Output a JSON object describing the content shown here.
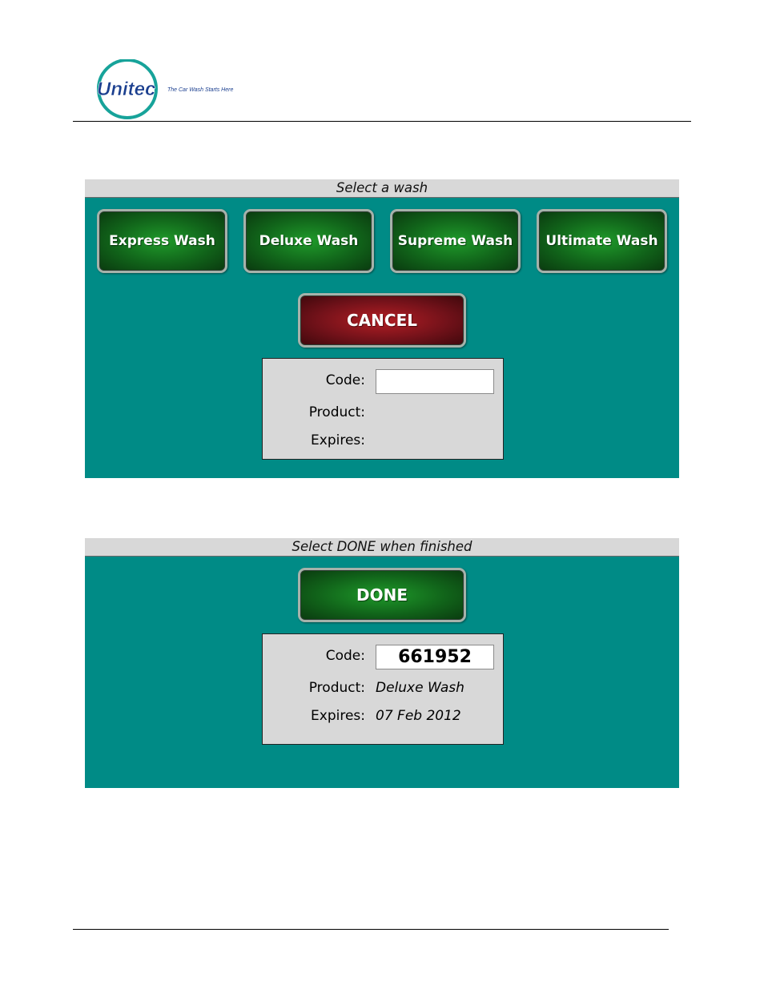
{
  "logo": {
    "brand": "Unitec",
    "tagline": "The Car Wash Starts Here"
  },
  "colors": {
    "panel_bg": "#008b86",
    "titlebar_bg": "#d8d8d8",
    "green_button": "#11641a",
    "red_button": "#74121a"
  },
  "screen1": {
    "title": "Select a wash",
    "wash_buttons": [
      {
        "label": "Express Wash"
      },
      {
        "label": "Deluxe Wash"
      },
      {
        "label": "Supreme Wash"
      },
      {
        "label": "Ultimate Wash"
      }
    ],
    "cancel_label": "CANCEL",
    "info": {
      "code_label": "Code:",
      "code_value": "",
      "product_label": "Product:",
      "product_value": "",
      "expires_label": "Expires:",
      "expires_value": ""
    }
  },
  "screen2": {
    "title": "Select DONE when finished",
    "done_label": "DONE",
    "info": {
      "code_label": "Code:",
      "code_value": "661952",
      "product_label": "Product:",
      "product_value": "Deluxe Wash",
      "expires_label": "Expires:",
      "expires_value": "07 Feb 2012"
    }
  }
}
